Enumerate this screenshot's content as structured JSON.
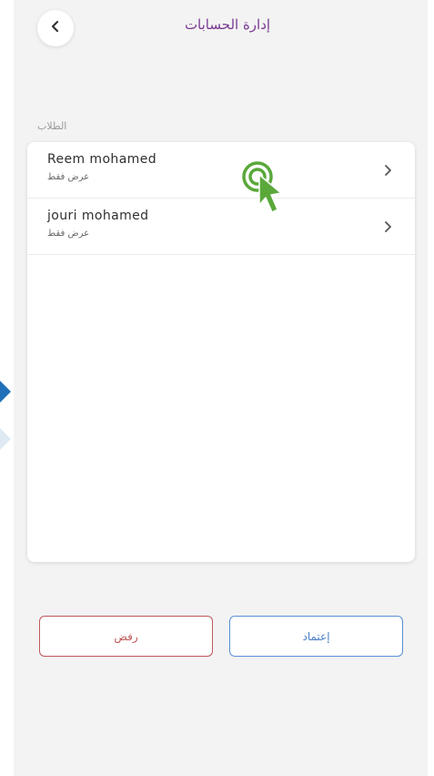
{
  "header": {
    "title": "إدارة الحسابات",
    "back_icon": "chevron-left-icon"
  },
  "section": {
    "label": "الطلاب"
  },
  "students": [
    {
      "name": "Reem mohamed",
      "permission": "عرض فقط"
    },
    {
      "name": "jouri mohamed",
      "permission": "عرض فقط"
    }
  ],
  "actions": {
    "reject_label": "رفض",
    "approve_label": "إعتماد"
  },
  "colors": {
    "title": "#7a3b92",
    "reject": "#c0575a",
    "approve": "#5a8fd6",
    "cursor": "#5aa83a"
  }
}
